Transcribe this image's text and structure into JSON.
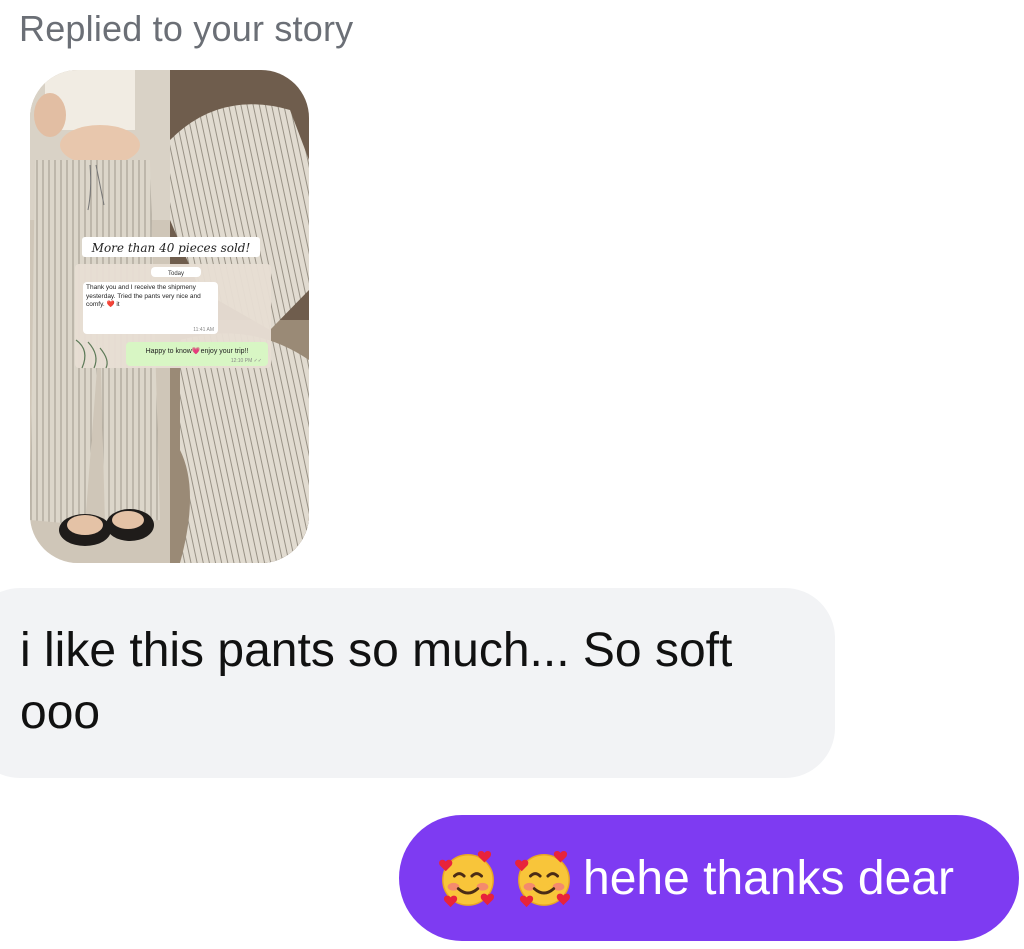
{
  "story_reply": {
    "label": "Replied to your story",
    "thumbnail": {
      "banner": "More than 40 pieces sold!",
      "chat_date": "Today",
      "chat_incoming_message": "Thank you and I receive the shipmeny yesterday. Tried the pants very nice and comfy. ❤️ it",
      "chat_incoming_time": "11:41 AM",
      "chat_outgoing_message": "Happy to know💗enjoy your trip!!",
      "chat_outgoing_time": "12:10 PM ✓✓"
    }
  },
  "messages": [
    {
      "direction": "incoming",
      "text_line1": "i like this pants so much... So soft",
      "text_line2": "ooo"
    },
    {
      "direction": "outgoing",
      "emojis": [
        "smiling-face-with-hearts",
        "smiling-face-with-hearts"
      ],
      "text": "hehe thanks dear"
    }
  ],
  "colors": {
    "incoming_bubble": "#f2f3f5",
    "outgoing_bubble": "#7e3bf2",
    "label_text": "#6b6f76"
  }
}
